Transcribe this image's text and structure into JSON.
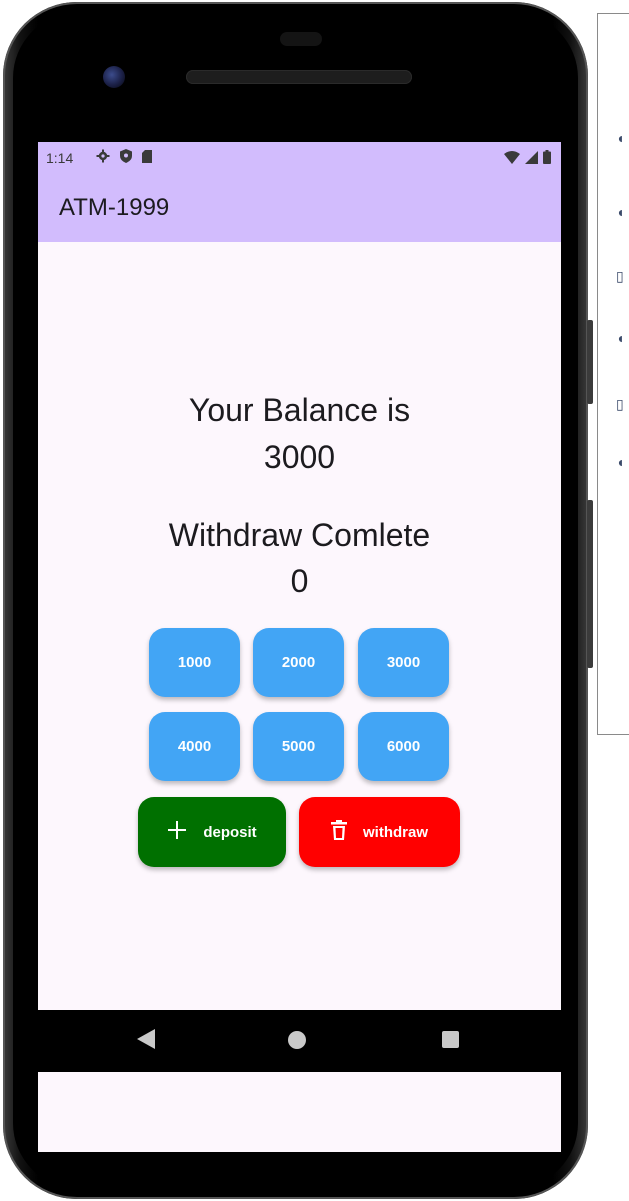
{
  "status_bar": {
    "time": "1:14",
    "background": "#d2bcfd",
    "left_icons": [
      "gear-icon",
      "shield-icon",
      "sd-card-icon"
    ],
    "right_icons": [
      "wifi-icon",
      "signal-icon",
      "battery-icon"
    ]
  },
  "app_bar": {
    "title": "ATM-1999",
    "background": "#d2bcfd"
  },
  "balance": {
    "label": "Your Balance is",
    "value": "3000"
  },
  "withdraw": {
    "label": "Withdraw Comlete",
    "value": "0"
  },
  "amount_buttons": [
    "1000",
    "2000",
    "3000",
    "4000",
    "5000",
    "6000"
  ],
  "amount_button_color": "#42a5f5",
  "actions": {
    "deposit": {
      "label": "deposit",
      "icon": "plus-icon",
      "color": "#007000"
    },
    "withdraw": {
      "label": "withdraw",
      "icon": "trash-icon",
      "color": "#ff0000"
    }
  },
  "nav_bar": {
    "buttons": [
      "back-icon",
      "home-icon",
      "recents-icon"
    ]
  }
}
